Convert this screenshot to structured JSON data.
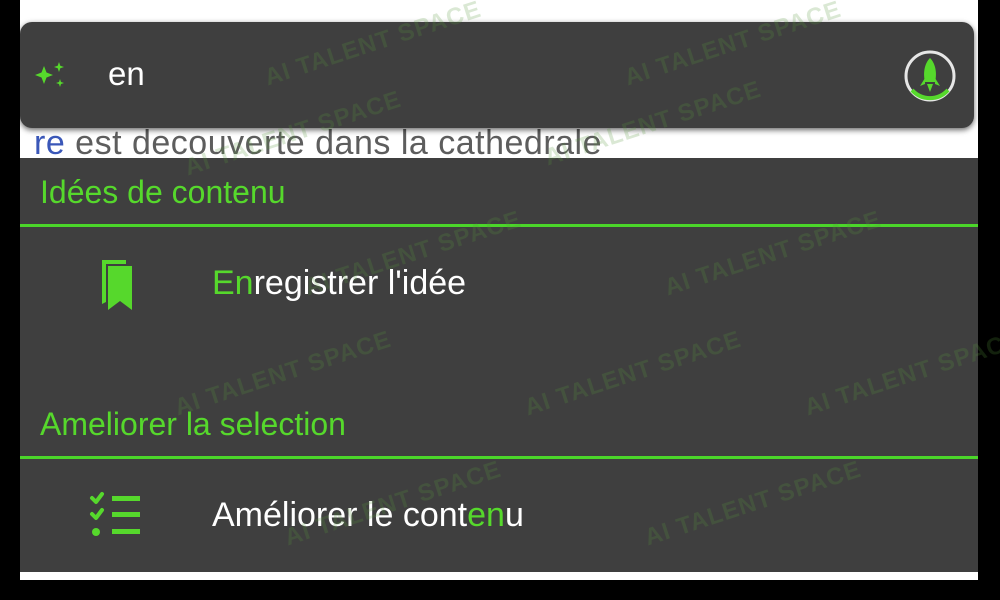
{
  "document": {
    "visible_text_link": "re",
    "visible_text": " est decouverte dans la cathedrale"
  },
  "search": {
    "value": "en",
    "icon": "sparkle-icon",
    "action_icon": "rocket-icon"
  },
  "menu": {
    "sections": [
      {
        "header": "Idées de contenu",
        "items": [
          {
            "icon": "bookmark-icon",
            "label_highlight": "En",
            "label_rest": "registrer l'idée"
          }
        ]
      },
      {
        "header": "Ameliorer la selection",
        "items": [
          {
            "icon": "checklist-icon",
            "label_before": "Améliorer le cont",
            "label_highlight": "en",
            "label_after": "u"
          }
        ]
      }
    ]
  },
  "watermark": {
    "text": "AI TALENT SPACE"
  },
  "colors": {
    "accent": "#56d82c",
    "panel": "#3f3f3f",
    "text": "#ffffff"
  }
}
